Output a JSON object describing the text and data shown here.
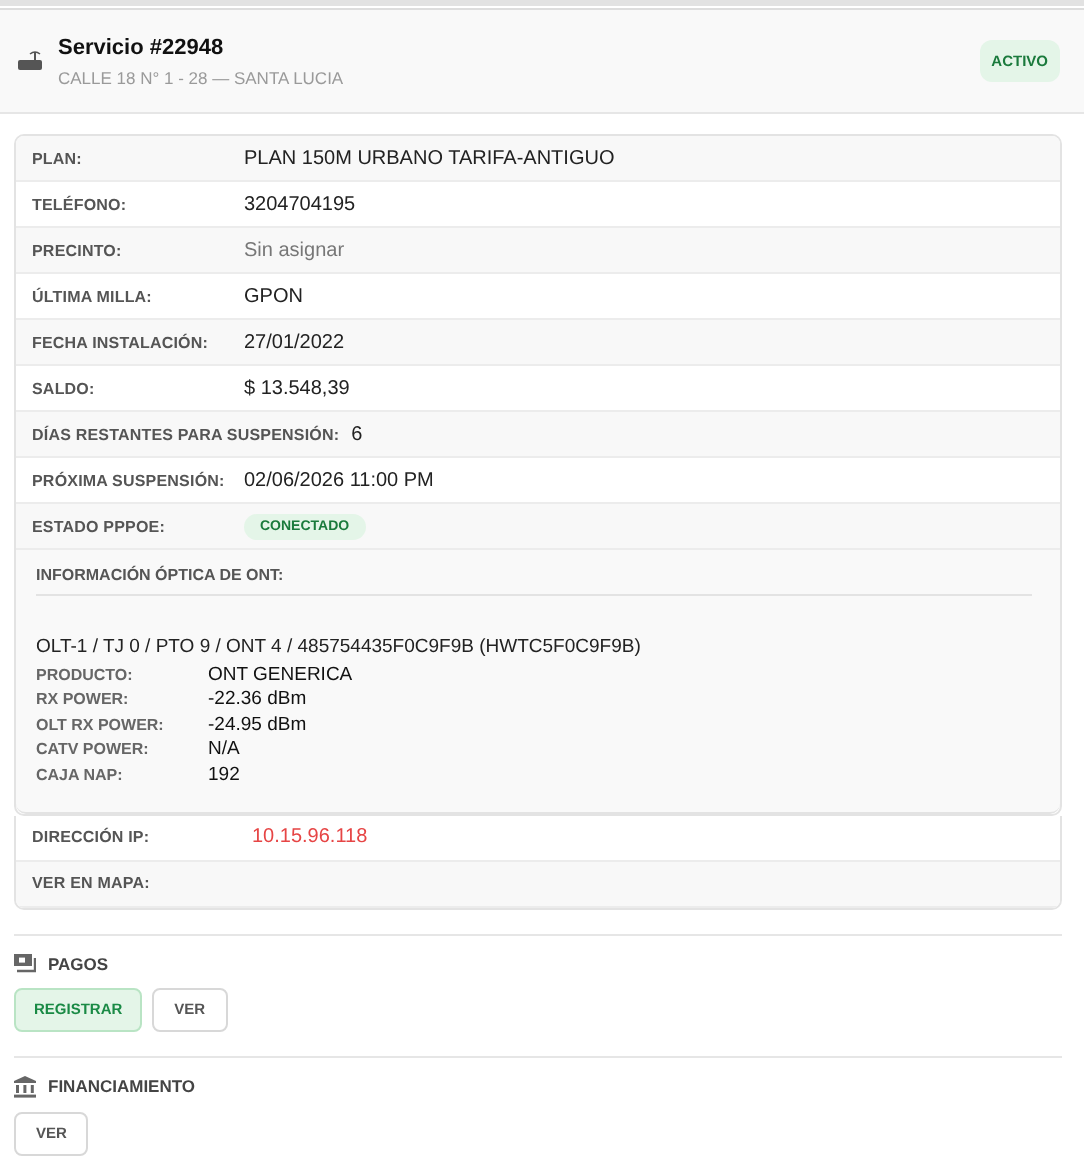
{
  "header": {
    "title": "Servicio #22948",
    "address": "CALLE 18 N° 1 - 28 — SANTA LUCIA",
    "status": "ACTIVO"
  },
  "details": [
    {
      "label": "PLAN:",
      "value": "PLAN 150M URBANO TARIFA-ANTIGUO",
      "kind": "text"
    },
    {
      "label": "TELÉFONO:",
      "value": "3204704195",
      "kind": "text"
    },
    {
      "label": "PRECINTO:",
      "value": "Sin asignar",
      "kind": "muted"
    },
    {
      "label": "ÚLTIMA MILLA:",
      "value": "GPON",
      "kind": "text"
    },
    {
      "label": "FECHA INSTALACIÓN:",
      "value": "27/01/2022",
      "kind": "text"
    },
    {
      "label": "SALDO:",
      "value": "$ 13.548,39",
      "kind": "text"
    },
    {
      "label": "DÍAS RESTANTES PARA SUSPENSIÓN:",
      "value": "6",
      "kind": "text"
    },
    {
      "label": "PRÓXIMA SUSPENSIÓN:",
      "value": "02/06/2026 11:00 PM",
      "kind": "text"
    },
    {
      "label": "ESTADO PPPOE:",
      "value": "CONECTADO",
      "kind": "badge"
    }
  ],
  "ont": {
    "title": "INFORMACIÓN ÓPTICA DE ONT:",
    "path": "OLT-1 / TJ 0 / PTO 9 / ONT 4 / 485754435F0C9F9B (HWTC5F0C9F9B)",
    "rows": [
      {
        "label": "PRODUCTO:",
        "value": "ONT GENERICA"
      },
      {
        "label": "RX POWER:",
        "value": "-22.36 dBm"
      },
      {
        "label": "OLT RX POWER:",
        "value": "-24.95 dBm"
      },
      {
        "label": "CATV POWER:",
        "value": "N/A"
      },
      {
        "label": "CAJA NAP:",
        "value": "192"
      }
    ]
  },
  "extra": [
    {
      "label": "DIRECCIÓN IP:",
      "value": "10.15.96.118",
      "kind": "alert"
    },
    {
      "label": "VER EN MAPA:",
      "kind": "empty"
    }
  ],
  "sections": [
    {
      "title": "PAGOS",
      "kind": "payments",
      "buttons": [
        {
          "label": "REGISTRAR",
          "kind": "primary"
        },
        {
          "label": "VER",
          "kind": "default"
        }
      ]
    },
    {
      "title": "FINANCIAMIENTO",
      "kind": "bank",
      "buttons": [
        {
          "label": "VER",
          "kind": "default"
        }
      ]
    }
  ]
}
